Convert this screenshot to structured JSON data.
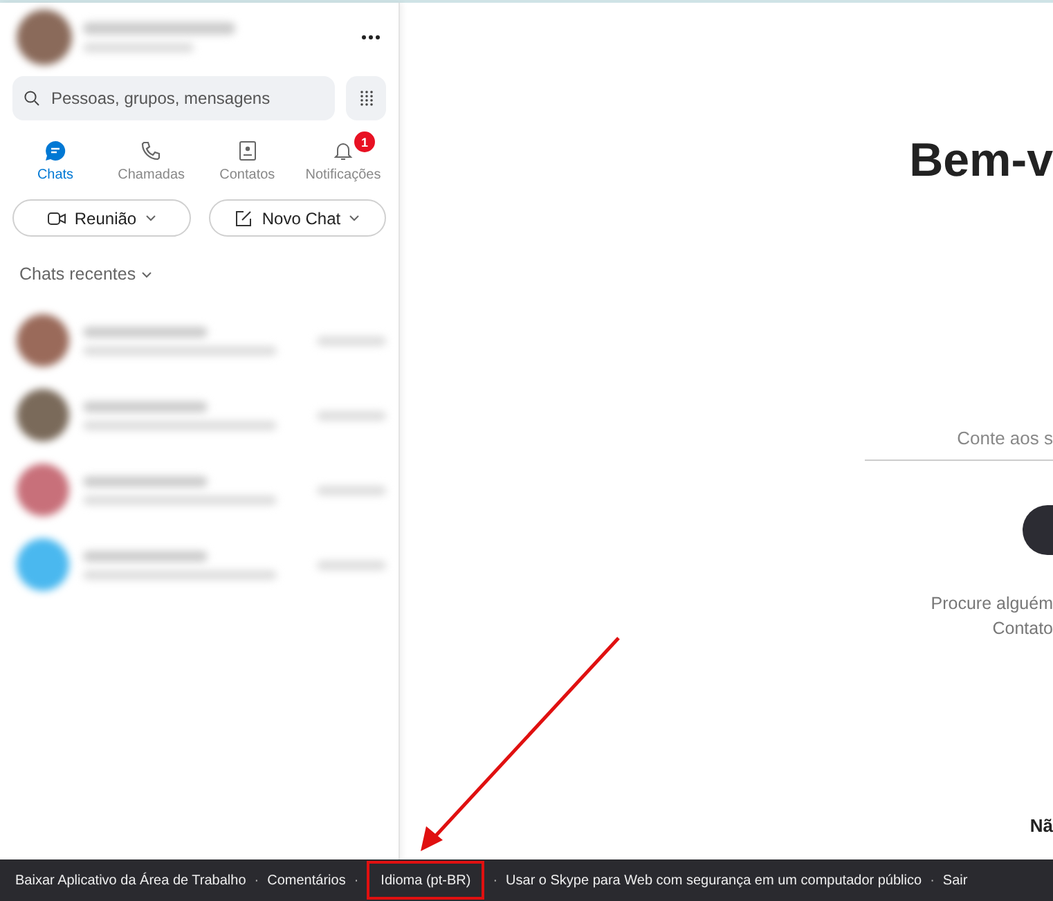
{
  "sidebar": {
    "search": {
      "placeholder": "Pessoas, grupos, mensagens"
    },
    "tabs": [
      {
        "label": "Chats",
        "selected": true,
        "kind": "chat"
      },
      {
        "label": "Chamadas",
        "selected": false,
        "kind": "phone"
      },
      {
        "label": "Contatos",
        "selected": false,
        "kind": "contacts"
      },
      {
        "label": "Notificações",
        "selected": false,
        "kind": "bell",
        "badge": "1"
      }
    ],
    "buttons": [
      {
        "label": "Reunião",
        "kind": "meet"
      },
      {
        "label": "Novo Chat",
        "kind": "compose"
      }
    ],
    "section_title": "Chats recentes",
    "recent_chats": [
      {
        "color": "#9a6a5a"
      },
      {
        "color": "#7a6a5a"
      },
      {
        "color": "#c8707a"
      },
      {
        "color": "#4ab8ef"
      }
    ]
  },
  "main": {
    "title": "Bem-v",
    "subtitle": "Conte aos s",
    "hint_lines": [
      "Procure alguém",
      "Contato"
    ],
    "bottom_text": "Nã"
  },
  "footer": [
    {
      "label": "Baixar Aplicativo da Área de Trabalho",
      "highlighted": false
    },
    {
      "separator": "·",
      "label": "Comentários",
      "highlighted": false
    },
    {
      "separator": "·",
      "label": "Idioma (pt-BR)",
      "highlighted": true
    },
    {
      "separator": "·",
      "label": "Usar o Skype para Web com segurança em um computador público",
      "highlighted": false
    },
    {
      "separator": "·",
      "label": "Sair",
      "highlighted": false
    }
  ]
}
